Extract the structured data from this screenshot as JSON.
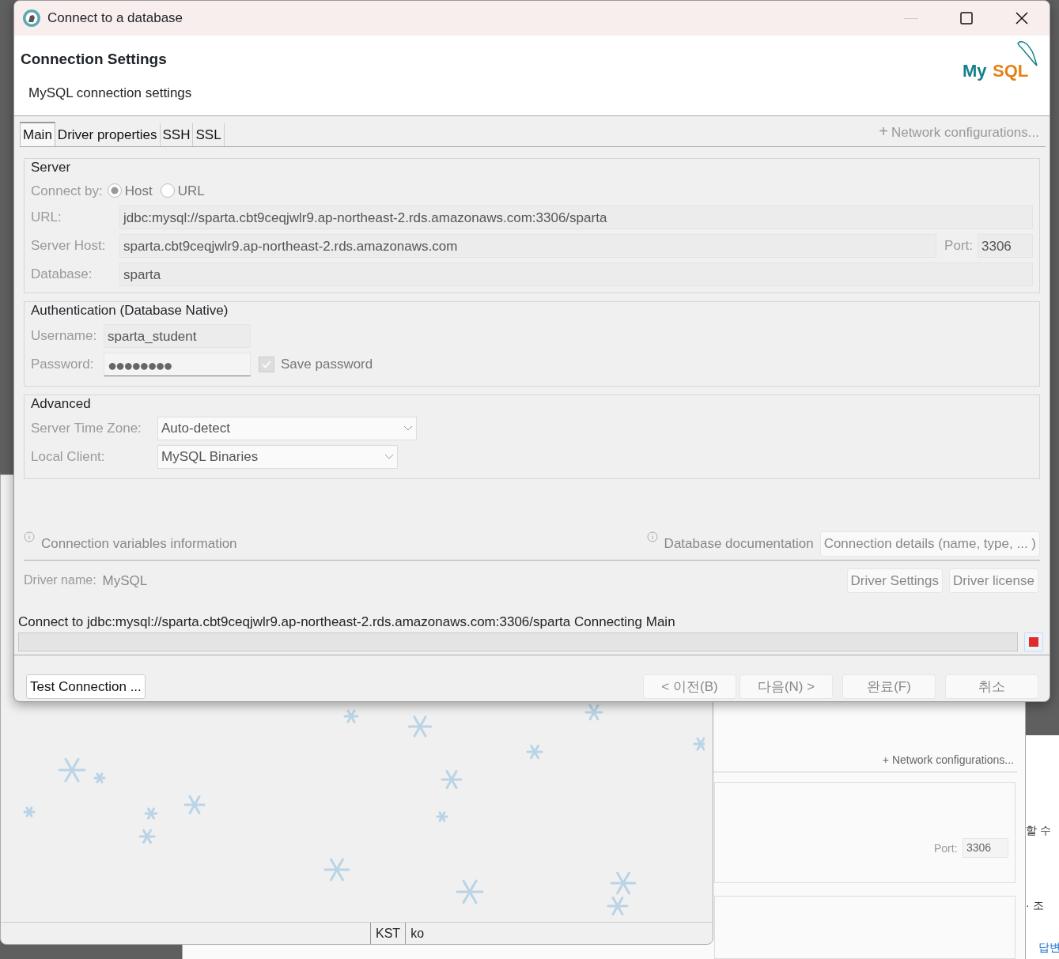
{
  "dialog": {
    "title": "Connect to a database",
    "heading": "Connection Settings",
    "subheading": "MySQL connection settings",
    "logo": {
      "part_1": "My",
      "part_2": "SQL"
    },
    "minimize_disabled": true
  },
  "tabs": [
    {
      "label": "Main",
      "selected": true
    },
    {
      "label": "Driver properties",
      "selected": false
    },
    {
      "label": "SSH",
      "selected": false
    },
    {
      "label": "SSL",
      "selected": false
    }
  ],
  "network_link": {
    "icon": "+",
    "label": "Network configurations..."
  },
  "server": {
    "title": "Server",
    "connect_by_label": "Connect by:",
    "options": [
      {
        "label": "Host",
        "selected": true
      },
      {
        "label": "URL",
        "selected": false
      }
    ],
    "url": {
      "label": "URL:",
      "value": "jdbc:mysql://sparta.cbt9ceqjwlr9.ap-northeast-2.rds.amazonaws.com:3306/sparta"
    },
    "host": {
      "label": "Server Host:",
      "value": "sparta.cbt9ceqjwlr9.ap-northeast-2.rds.amazonaws.com"
    },
    "port": {
      "label": "Port:",
      "value": "3306"
    },
    "database": {
      "label": "Database:",
      "value": "sparta"
    }
  },
  "authentication": {
    "title": "Authentication (Database Native)",
    "username": {
      "label": "Username:",
      "value": "sparta_student"
    },
    "password": {
      "label": "Password:",
      "value": "●●●●●●●●"
    },
    "save_password": {
      "label": "Save password",
      "checked": true
    }
  },
  "advanced": {
    "title": "Advanced",
    "fields": [
      {
        "label": "Server Time Zone:",
        "value": "Auto-detect"
      },
      {
        "label": "Local Client:",
        "value": "MySQL Binaries"
      }
    ]
  },
  "info_links": [
    "Connection variables information",
    "Database documentation"
  ],
  "details_button": "Connection details (name, type, ... )",
  "driver": {
    "label": "Driver name:",
    "value": "MySQL",
    "buttons": [
      "Driver Settings",
      "Driver license"
    ]
  },
  "progress": {
    "message": "Connect to jdbc:mysql://sparta.cbt9ceqjwlr9.ap-northeast-2.rds.amazonaws.com:3306/sparta Connecting Main",
    "level": 0
  },
  "test_button": "Test Connection ...",
  "nav_buttons": [
    {
      "label": "< 이전(B)",
      "disabled": true
    },
    {
      "label": "다음(N) >",
      "disabled": true
    },
    {
      "label": "완료(F)",
      "disabled": true
    },
    {
      "label": "취소",
      "disabled": true
    }
  ],
  "background": {
    "status_bar": [
      "KST",
      "ko"
    ],
    "network_link": "+ Network configurations...",
    "port_label": "Port:",
    "port": "3306",
    "side_texts": [
      "할 수",
      "· 조",
      "답변"
    ]
  }
}
